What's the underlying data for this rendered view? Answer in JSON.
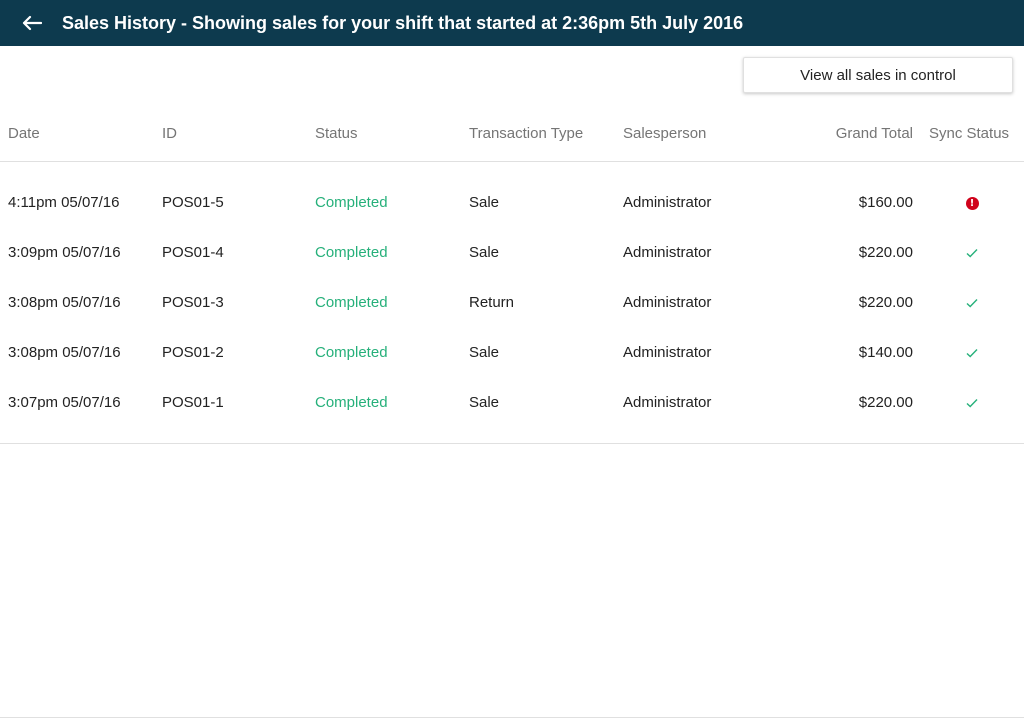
{
  "header": {
    "title": "Sales History - Showing sales for your shift that started at 2:36pm 5th July 2016",
    "back_icon": "arrow-left-icon",
    "background": "#0d3a4e"
  },
  "toolbar": {
    "view_all_label": "View all sales in control"
  },
  "table": {
    "columns": [
      "Date",
      "ID",
      "Status",
      "Transaction Type",
      "Salesperson",
      "Grand Total",
      "Sync Status"
    ],
    "rows": [
      {
        "date": "4:11pm 05/07/16",
        "id": "POS01-5",
        "status": "Completed",
        "type": "Sale",
        "salesperson": "Administrator",
        "total": "$160.00",
        "sync": "error"
      },
      {
        "date": "3:09pm 05/07/16",
        "id": "POS01-4",
        "status": "Completed",
        "type": "Sale",
        "salesperson": "Administrator",
        "total": "$220.00",
        "sync": "synced"
      },
      {
        "date": "3:08pm 05/07/16",
        "id": "POS01-3",
        "status": "Completed",
        "type": "Return",
        "salesperson": "Administrator",
        "total": "$220.00",
        "sync": "synced"
      },
      {
        "date": "3:08pm 05/07/16",
        "id": "POS01-2",
        "status": "Completed",
        "type": "Sale",
        "salesperson": "Administrator",
        "total": "$140.00",
        "sync": "synced"
      },
      {
        "date": "3:07pm 05/07/16",
        "id": "POS01-1",
        "status": "Completed",
        "type": "Sale",
        "salesperson": "Administrator",
        "total": "$220.00",
        "sync": "synced"
      }
    ]
  },
  "colors": {
    "status_completed": "#26b07a",
    "sync_ok": "#26b07a",
    "sync_error": "#d0021b"
  }
}
